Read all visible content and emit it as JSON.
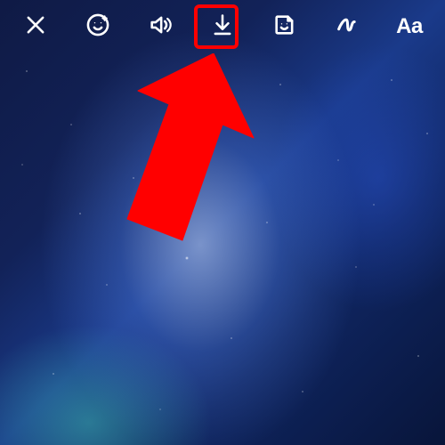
{
  "toolbar": {
    "items": [
      {
        "name": "close-button",
        "icon": "close-icon",
        "interactable": true
      },
      {
        "name": "effects-button",
        "icon": "face-icon",
        "interactable": true
      },
      {
        "name": "sound-button",
        "icon": "speaker-icon",
        "interactable": true
      },
      {
        "name": "download-button",
        "icon": "download-icon",
        "interactable": true
      },
      {
        "name": "sticker-button",
        "icon": "sticker-icon",
        "interactable": true
      },
      {
        "name": "draw-button",
        "icon": "scribble-icon",
        "interactable": true
      },
      {
        "name": "text-button",
        "label": "Aa",
        "interactable": true
      }
    ]
  },
  "annotations": {
    "highlight_target": "download-button",
    "highlight_color": "#ff0000",
    "arrow_color": "#ff0000"
  }
}
